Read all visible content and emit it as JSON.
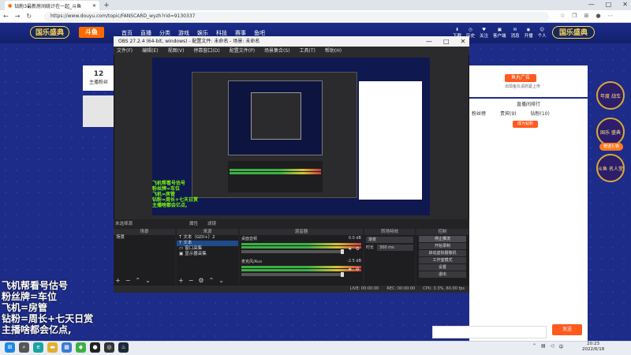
{
  "browser": {
    "tab_title": "钻粉3最新房间统计在一起_斗鱼",
    "new_tab": "+",
    "url": "https://www.douyu.com/topic/FANSCARD_wyzh?rid=9130337",
    "window_controls": [
      "—",
      "□",
      "✕"
    ]
  },
  "site": {
    "logo_left": "国乐盛典",
    "logo_brand": "斗鱼",
    "nav": [
      "首页",
      "直播",
      "分类",
      "游戏",
      "娱乐",
      "科技",
      "赛事",
      "鱼吧"
    ],
    "nav_right": [
      "下载",
      "历史",
      "关注",
      "客户端",
      "消息",
      "开播",
      "个人"
    ],
    "logo_right": "国乐盛典"
  },
  "stream": {
    "left_count": "12",
    "left_count_label": "主播粉丝",
    "danmu_lines": [
      "飞机帮看号估号",
      "粉丝牌=车位",
      "飞机=房管",
      "钻粉=周长+七天日赏",
      "主播啥都会亿点,"
    ]
  },
  "right": {
    "yuwan_label": "鱼丸广告",
    "yuwan_note": "出现鱼丸请抓紧上传",
    "rank_title": "直播间排行",
    "chat_tabs": [
      "粉丝榜",
      "贵宾(9)",
      "钻粉(10)"
    ],
    "chat_badge": "成为钻粉",
    "badges": [
      "年度\n战车",
      "国乐\n盛典",
      "斗鱼\n名人堂"
    ],
    "side_button": "赠送礼物",
    "send": "发送"
  },
  "obs": {
    "title": "OBS 27.2.4 (64-bit, windows) - 配置文件: 未命名 - 场景: 未命名",
    "menu": [
      "文件(F)",
      "编辑(E)",
      "视图(V)",
      "停靠窗口(D)",
      "配置文件(P)",
      "场景集合(S)",
      "工具(T)",
      "帮助(H)"
    ],
    "no_source": "未选择源",
    "props": "属性",
    "filters": "滤镜",
    "scenes_head": "场景",
    "scenes": [
      "场景"
    ],
    "sources_head": "来源",
    "sources": [
      "文本（GDI+）2",
      "文本",
      "窗口采集",
      "显示器采集"
    ],
    "mixer_head": "混音器",
    "mixer_tracks": [
      "桌面音频",
      "麦克风/Aux"
    ],
    "mixer_db": [
      "0.0 dB",
      "-2.5 dB"
    ],
    "trans_head": "转场特效",
    "trans_type": "渐变",
    "trans_duration_label": "时长",
    "trans_duration": "300 ms",
    "controls_head": "控制",
    "controls": [
      "停止推流",
      "开始录制",
      "启动虚拟摄像机",
      "工作室模式",
      "设置",
      "退出"
    ],
    "status": [
      "LIVE: 00:00:00",
      "REC: 00:00:00",
      "CPU: 0.3%, 60.00 fps"
    ]
  },
  "taskbar": {
    "time": "20:23",
    "date": "2022/6/18"
  }
}
